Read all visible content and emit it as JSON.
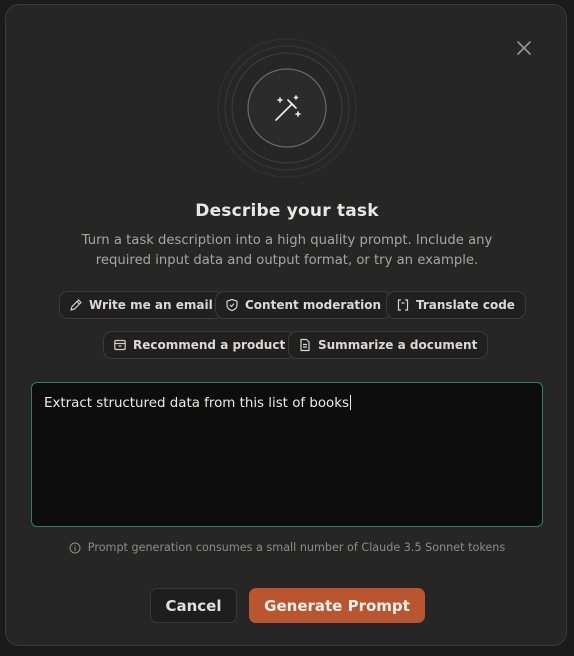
{
  "dialog": {
    "title": "Describe your task",
    "description": "Turn a task description into a high quality prompt. Include any required input data and output format, or try an example.",
    "close_icon": "close-icon",
    "hero_icon": "magic-wand-icon"
  },
  "examples": [
    {
      "label": "Write me an email",
      "icon": "pen-icon"
    },
    {
      "label": "Content moderation",
      "icon": "shield-icon"
    },
    {
      "label": "Translate code",
      "icon": "code-bracket-icon"
    },
    {
      "label": "Recommend a product",
      "icon": "box-icon"
    },
    {
      "label": "Summarize a document",
      "icon": "document-icon"
    }
  ],
  "task_input": {
    "value": "Extract structured data from this list of books"
  },
  "note": {
    "text": "Prompt generation consumes a small number of Claude 3.5 Sonnet tokens",
    "icon": "info-icon"
  },
  "actions": {
    "cancel_label": "Cancel",
    "generate_label": "Generate Prompt"
  },
  "colors": {
    "accent": "#b9552f",
    "input_border": "#2f7d63",
    "background": "#262626"
  }
}
